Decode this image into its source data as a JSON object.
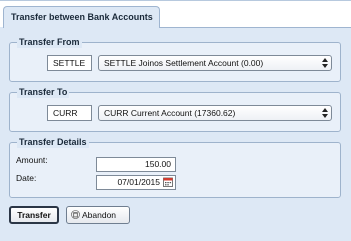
{
  "tab": {
    "label": "Transfer between Bank Accounts"
  },
  "transfer_from": {
    "legend": "Transfer From",
    "code": "SETTLE",
    "account": "SETTLE Joinos Settlement Account (0.00)"
  },
  "transfer_to": {
    "legend": "Transfer To",
    "code": "CURR",
    "account": "CURR Current Account (17360.62)"
  },
  "details": {
    "legend": "Transfer Details",
    "amount_label": "Amount:",
    "amount_value": "150.00",
    "date_label": "Date:",
    "date_value": "07/01/2015"
  },
  "buttons": {
    "transfer": "Transfer",
    "abandon": "Abandon"
  },
  "icons": {
    "select_arrows": "updown-arrows-icon",
    "calendar": "calendar-icon",
    "abandon": "trash-icon"
  }
}
